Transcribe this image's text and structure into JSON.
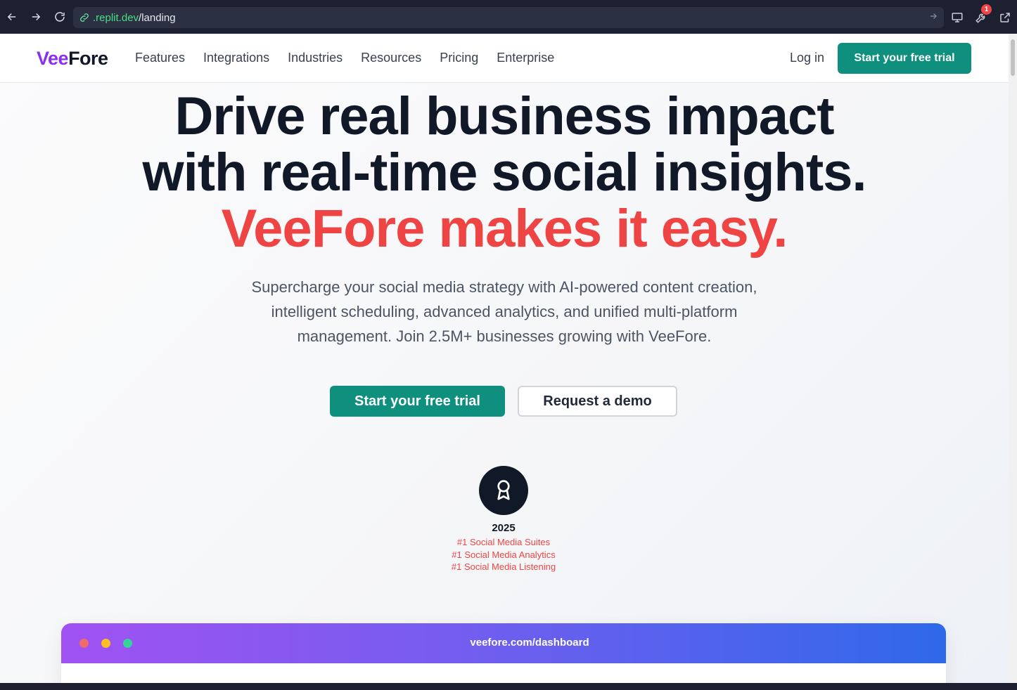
{
  "browser": {
    "url_host": ".replit.dev",
    "url_path": "/landing",
    "notification_count": "1"
  },
  "header": {
    "logo_part1": "Vee",
    "logo_part2": "Fore",
    "nav": [
      "Features",
      "Integrations",
      "Industries",
      "Resources",
      "Pricing",
      "Enterprise"
    ],
    "login": "Log in",
    "cta": "Start your free trial"
  },
  "hero": {
    "title_line1": "Drive real business impact",
    "title_line2": "with real-time social insights.",
    "title_accent": "VeeFore makes it easy.",
    "subtitle": "Supercharge your social media strategy with AI-powered content creation, intelligent scheduling, advanced analytics, and unified multi-platform management. Join 2.5M+ businesses growing with VeeFore.",
    "primary_button": "Start your free trial",
    "secondary_button": "Request a demo"
  },
  "award": {
    "icon": "award-ribbon-icon",
    "year": "2025",
    "items": [
      "#1 Social Media Suites",
      "#1 Social Media Analytics",
      "#1 Social Media Listening"
    ]
  },
  "dashboard": {
    "url": "veefore.com/dashboard"
  },
  "colors": {
    "brand_purple": "#8b2ff0",
    "primary_teal": "#0f8f7e",
    "accent_red": "#ef4444",
    "dark": "#111827"
  }
}
